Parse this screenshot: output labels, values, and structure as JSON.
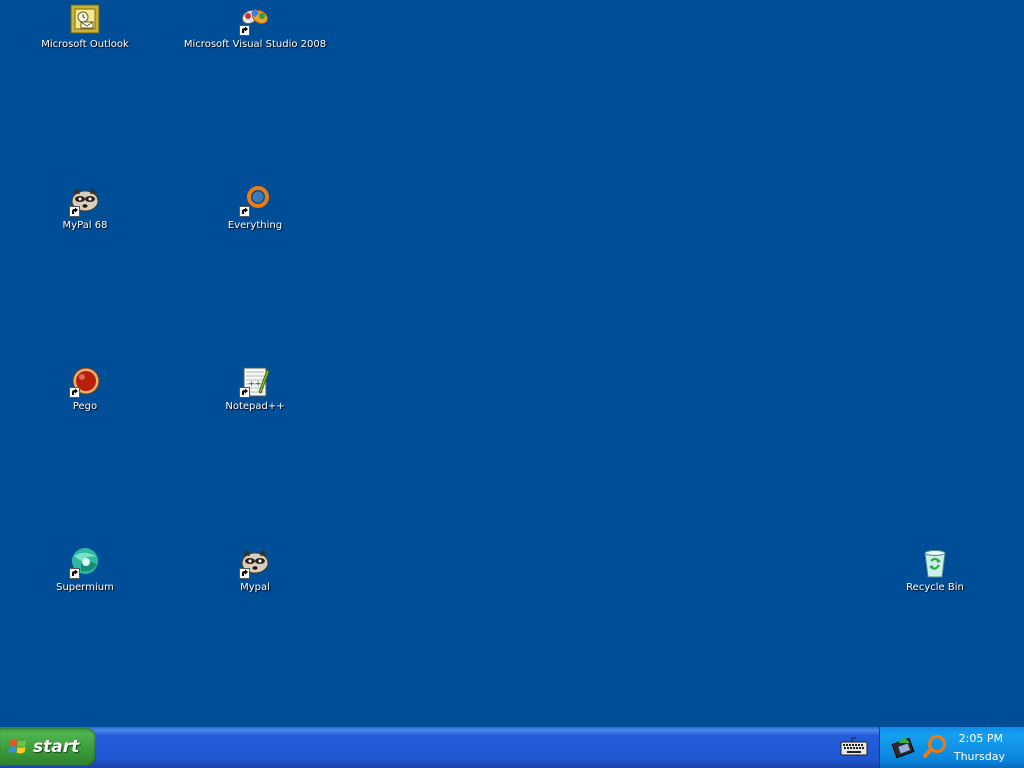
{
  "desktop": {
    "background_color": "#004e98",
    "icons": {
      "outlook": {
        "label": "Microsoft Outlook",
        "icon": "outlook-icon",
        "shortcut": false
      },
      "visual_studio": {
        "label": "Microsoft Visual Studio 2008",
        "icon": "visual-studio-icon",
        "shortcut": true
      },
      "mypal68": {
        "label": "MyPal 68",
        "icon": "mypal-raccoon-icon",
        "shortcut": true
      },
      "everything": {
        "label": "Everything",
        "icon": "everything-search-icon",
        "shortcut": true
      },
      "pego": {
        "label": "Pego",
        "icon": "pego-red-orb-icon",
        "shortcut": true
      },
      "notepadpp": {
        "label": "Notepad++",
        "icon": "notepad-plus-plus-icon",
        "shortcut": true
      },
      "supermium": {
        "label": "Supermium",
        "icon": "supermium-icon",
        "shortcut": true
      },
      "mypal": {
        "label": "Mypal",
        "icon": "mypal-raccoon-icon",
        "shortcut": true
      },
      "recycle_bin": {
        "label": "Recycle Bin",
        "icon": "recycle-bin-icon",
        "shortcut": false
      }
    }
  },
  "taskbar": {
    "start_label": "start",
    "tray": {
      "time": "2:05 PM",
      "day": "Thursday"
    }
  }
}
